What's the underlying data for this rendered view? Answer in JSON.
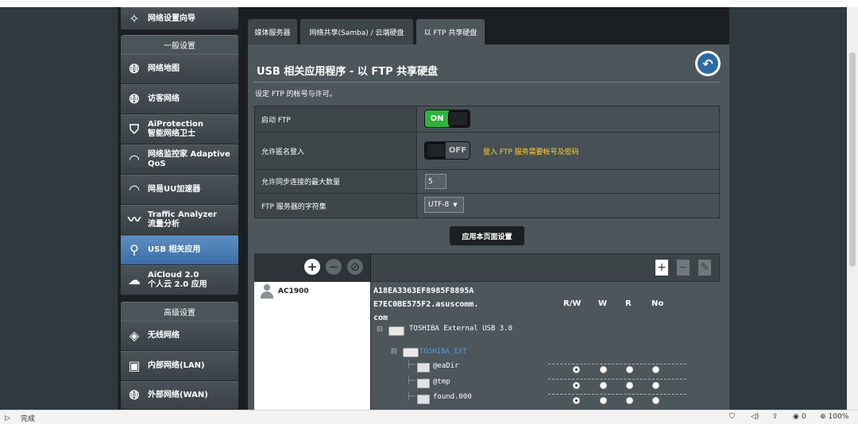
{
  "sidebar": {
    "wizard": "网络设置向导",
    "general_header": "一般设置",
    "general_items": [
      {
        "line1": "网络地图",
        "line2": ""
      },
      {
        "line1": "访客网络",
        "line2": ""
      },
      {
        "line1": "AiProtection",
        "line2": "智能网络卫士"
      },
      {
        "line1": "网络监控家 Adaptive",
        "line2": "QoS"
      },
      {
        "line1": "网易UU加速器",
        "line2": ""
      },
      {
        "line1": "Traffic Analyzer",
        "line2": "流量分析"
      },
      {
        "line1": "USB 相关应用",
        "line2": ""
      },
      {
        "line1": "AiCloud 2.0",
        "line2": "个人云 2.0 应用"
      }
    ],
    "advanced_header": "高级设置",
    "advanced_items": [
      {
        "line1": "无线网络"
      },
      {
        "line1": "内部网络(LAN)"
      },
      {
        "line1": "外部网络(WAN)"
      }
    ]
  },
  "tabs": [
    "媒体服务器",
    "网络共享(Samba) / 云端硬盘",
    "以 FTP 共享硬盘"
  ],
  "panel": {
    "title": "USB 相关应用程序 - 以 FTP 共享硬盘",
    "description": "设定 FTP 的帐号与许可。"
  },
  "settings": {
    "enable_ftp_label": "启动 FTP",
    "enable_ftp_state": "ON",
    "anon_label": "允许匿名登入",
    "anon_state": "OFF",
    "anon_hint": "登入 FTP 服务需要帐号及密码",
    "max_conn_label": "允许同步连接的最大数量",
    "max_conn_value": "5",
    "charset_label": "FTP 服务器的字符集",
    "charset_value": "UTF-8"
  },
  "apply_button": "应用本页面设置",
  "accounts": {
    "list": [
      "AC1900"
    ],
    "host_line1": "A18EA3363EF8985F8895A",
    "host_line2": "E7EC0BE575F2.asuscomm.",
    "host_line3": "com",
    "perm_headers": [
      "R/W",
      "W",
      "R",
      "No"
    ],
    "drive": "TOSHIBA External USB 3.0",
    "volume": "TOSHIBA_EXT",
    "folders": [
      {
        "name": "@eaDir",
        "selected": 0
      },
      {
        "name": "@tmp",
        "selected": 0
      },
      {
        "name": "found.000",
        "selected": 0
      }
    ]
  },
  "statusbar": {
    "status": "完成",
    "download_count": "0",
    "zoom": "100%"
  },
  "colors": {
    "on_green": "#2db33d",
    "hint_yellow": "#ffcc33",
    "active_blue": "#3c6ea6"
  }
}
